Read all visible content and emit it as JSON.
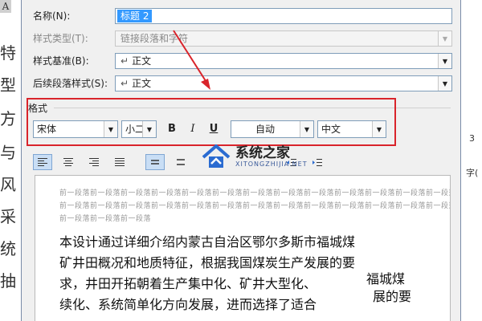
{
  "background": {
    "left_chars": [
      "A",
      "特",
      "型",
      "方",
      "与",
      "风",
      "采",
      "统",
      "抽"
    ],
    "right_num": "3",
    "right_text": "字("
  },
  "dialog": {
    "name_label": "名称(N):",
    "name_value": "标题 2",
    "style_type_label": "样式类型(T):",
    "style_type_value": "链接段落和字符",
    "style_based_label": "样式基准(B):",
    "style_based_value": "正文",
    "next_style_label": "后续段落样式(S):",
    "next_style_value": "正文",
    "format_group": "格式",
    "font": "宋体",
    "size": "小二",
    "bold": "B",
    "italic": "I",
    "underline": "U",
    "color": "自动",
    "language": "中文"
  },
  "preview": {
    "prev_para_line1": "前一段落前一段落前一段落前一段落前一段落前一段落前一段落前一段落前一段落前一段落前一段落前一段落前一段落",
    "prev_para_line2": "前一段落前一段落前一段落前一段落前一段落前一段落前一段落前一段落前一段落前一段落前一段落前一段落前一段落",
    "prev_para_line3": "前一段落前一段落前一段落",
    "lines": [
      "本设计通过详细介绍内蒙古自治区鄂尔多斯市福城煤",
      "矿井田概况和地质特征，根据我国煤炭生产发展的要",
      "求，井田开拓朝着生产集中化、矿井大型化、",
      "续化、系统简单化方向发展，进而选择了适合"
    ],
    "overlay1": "福城煤",
    "overlay2": "展的要"
  },
  "watermark": {
    "title": "系统之家",
    "subtitle": "XITONGZHIJIA.NET"
  },
  "colors": {
    "highlight": "#3399ff",
    "annotation": "#d9242b"
  }
}
